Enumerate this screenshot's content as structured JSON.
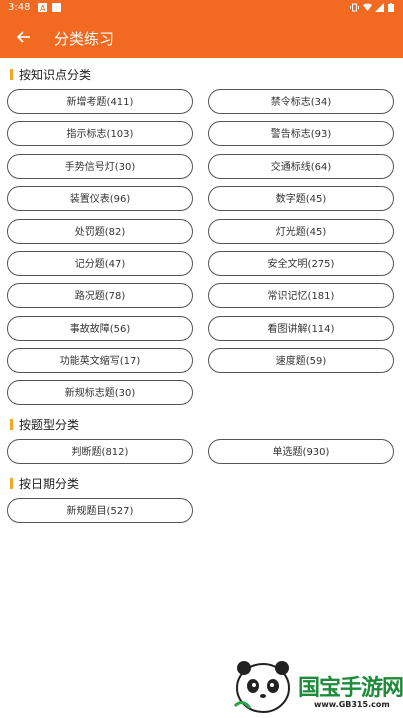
{
  "status": {
    "time": "3:48"
  },
  "appbar": {
    "title": "分类练习"
  },
  "sections": {
    "knowledge": {
      "label": "按知识点分类"
    },
    "type": {
      "label": "按题型分类"
    },
    "date": {
      "label": "按日期分类"
    }
  },
  "knowledge_items": [
    "新增考题(411)",
    "禁令标志(34)",
    "指示标志(103)",
    "警告标志(93)",
    "手势信号灯(30)",
    "交通标线(64)",
    "装置仪表(96)",
    "数字题(45)",
    "处罚题(82)",
    "灯光题(45)",
    "记分题(47)",
    "安全文明(275)",
    "路况题(78)",
    "常识记忆(181)",
    "事故故障(56)",
    "看图讲解(114)",
    "功能英文缩写(17)",
    "速度题(59)",
    "新规标志题(30)"
  ],
  "type_items": [
    "判断题(812)",
    "单选题(930)"
  ],
  "date_items": [
    "新规题目(527)"
  ],
  "watermark": {
    "text": "国宝手游网",
    "url": "www.GB315.com"
  }
}
